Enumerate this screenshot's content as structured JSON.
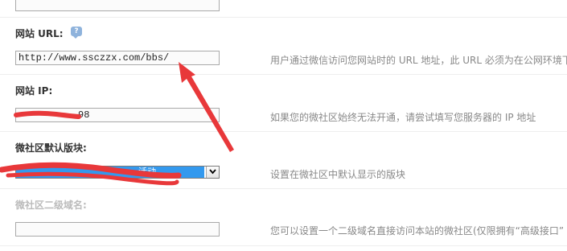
{
  "site_url": {
    "label": "网站 URL:",
    "value": "http://www.ssczzx.com/bbs/",
    "hint": "用户通过微信访问您网站时的 URL 地址，此 URL 必须为在公网环境下"
  },
  "site_ip": {
    "label": "网站 IP:",
    "value": "98",
    "hint": "如果您的微社区始终无法开通，请尝试填写您服务器的 IP 地址"
  },
  "default_board": {
    "label": "微社区默认版块:",
    "selected": "活动",
    "hint": "设置在微社区中默认显示的版块"
  },
  "subdomain": {
    "label": "微社区二级域名:",
    "value": "",
    "hint": "您可以设置一个二级域名直接访问本站的微社区(仅限拥有“高级接口”"
  },
  "colors": {
    "annotation_red": "#e8383a",
    "select_highlight": "#3399ee"
  }
}
